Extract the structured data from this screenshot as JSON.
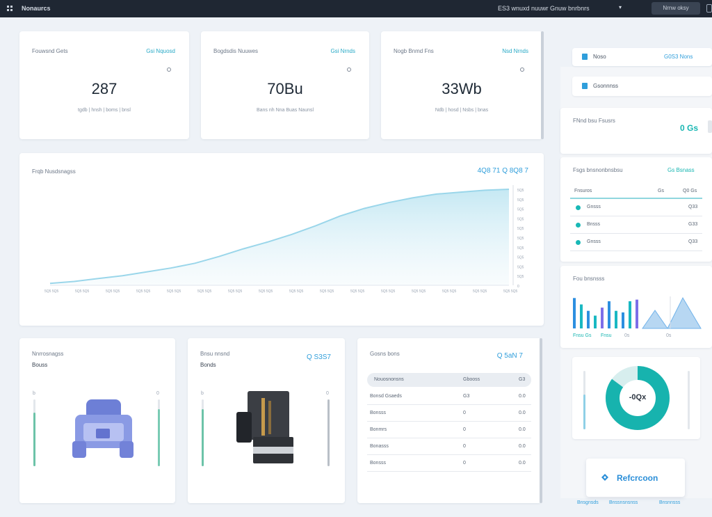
{
  "topbar": {
    "brand": "Nonaurcs",
    "title": "ES3 wnuxd nuuwr Gnuw bnrbnrs",
    "caret": "▾",
    "button": "Nrnw oksy"
  },
  "stats": [
    {
      "title": "Fouwsnd Gets",
      "link": "Gsi Nquosd",
      "value": "287",
      "sub": "tgdb | hnsh | boms | bnsl"
    },
    {
      "title": "Bogdsdis Nuuwes",
      "link": "Gsi Nrnds",
      "value": "70Bu",
      "sub": "Bans nh Nna Buas Naunsl"
    },
    {
      "title": "Nogb Bnmd Fns",
      "link": "Nsd Nrnds",
      "value": "33Wb",
      "sub": "Ndb | hosd | Nsbs | bnas"
    }
  ],
  "main_chart": {
    "title": "Frqb Nusdsnagss",
    "legend": "4Q8 71 Q 8Q8 7",
    "y_ticks": [
      "5Q5",
      "5Q5",
      "5Q5",
      "5Q5",
      "5Q5",
      "5Q5",
      "5Q5",
      "5Q5",
      "5Q5",
      "5Q5",
      "0"
    ],
    "x_ticks": [
      "5Q5 5Q5",
      "5Q5 5Q5",
      "5Q5 5Q5",
      "5Q5 5Q5",
      "5Q5 5Q5",
      "5Q5 5Q5",
      "5Q5 5Q5",
      "5Q5 5Q5",
      "5Q5 5Q5",
      "5Q5 5Q5",
      "5Q5 5Q5",
      "5Q5 5Q5",
      "5Q5 5Q5",
      "5Q5 5Q5",
      "5Q5 5Q5",
      "5Q5 5Q5"
    ],
    "series": [
      0.02,
      0.04,
      0.07,
      0.1,
      0.14,
      0.18,
      0.23,
      0.3,
      0.38,
      0.45,
      0.53,
      0.62,
      0.72,
      0.8,
      0.86,
      0.91,
      0.95,
      0.97,
      0.99,
      1.0
    ],
    "color": "#9ad6ea"
  },
  "panels": [
    {
      "title": "Nnrrosnagss",
      "sub": "Bouss",
      "left_level": 0.8,
      "right_level": 0.85,
      "left_tick": "b",
      "right_tick": "0"
    },
    {
      "title": "Bnsu nnsnd",
      "sub": "Bonds",
      "link": "Q S3S7",
      "left_level": 0.85,
      "right_level": 0.0,
      "left_tick": "b",
      "right_tick": "0"
    }
  ],
  "table": {
    "title": "Gosns bons",
    "link": "Q 5aN 7",
    "headers": [
      "Nouosnonsns",
      "Gbooss",
      "G3"
    ],
    "rows": [
      [
        "Bonsd Gsaeds",
        "G3",
        "0.0"
      ],
      [
        "Bonsss",
        "0",
        "0.0"
      ],
      [
        "Bonmrs",
        "0",
        "0.0"
      ],
      [
        "Bonasss",
        "0",
        "0.0"
      ],
      [
        "Bonsss",
        "0",
        "0.0"
      ]
    ]
  },
  "side": {
    "pill1": "Noso",
    "pill1_link": "G0S3 Nons",
    "pill2": "Gsonnnss",
    "summary_title": "FNnd bsu Fsusrs",
    "summary_value": "0 Gs",
    "list_title": "Fsgs bnsnonbnsbsu",
    "list_link": "Gs Bsnass",
    "list_head": [
      "Fnsuros",
      "Gs",
      "Q0 Gs"
    ],
    "list_rows": [
      {
        "label": "Gnsss",
        "value": "Q33"
      },
      {
        "label": "Bnsss",
        "value": "G33"
      },
      {
        "label": "Gnsss",
        "value": "Q33"
      }
    ],
    "bars_title": "Fou bnsnsss",
    "bar_values": [
      0.95,
      0.75,
      0.55,
      0.4,
      0.65,
      0.85,
      0.55,
      0.5,
      0.85,
      0.9
    ],
    "bar_colors": [
      "#2c8fe0",
      "#19b8c2",
      "#2c8fe0",
      "#19b8c2",
      "#7d6ee8",
      "#2c8fe0",
      "#19b8c2",
      "#2c8fe0",
      "#19b8c2",
      "#7d6ee8"
    ],
    "bar_labels": [
      "Fnsu Gs",
      "Fnsu",
      "0s",
      "0s"
    ],
    "donut_value": "-0Qx",
    "donut_fraction": 0.85,
    "refresh": "Refcrcoon",
    "footer": [
      "Bnsgnsds",
      "Bnssnsnsnss",
      "Bnsnnsss"
    ]
  }
}
